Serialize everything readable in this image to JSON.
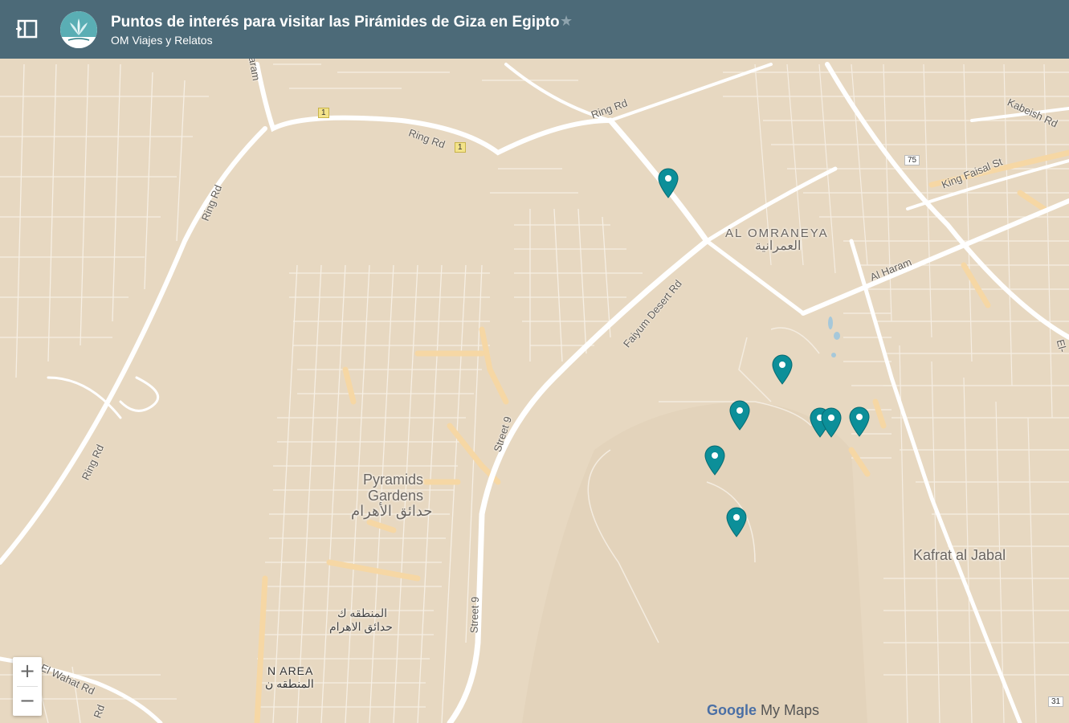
{
  "header": {
    "title": "Puntos de interés para visitar las Pirámides de Giza en Egipto",
    "author": "OM Viajes y Relatos",
    "star_icon": "star-icon",
    "toggle_icon": "sidebar-toggle-icon"
  },
  "map": {
    "roads": {
      "ring_rd_top": "Ring Rd",
      "ring_rd_mid": "Ring Rd",
      "ring_rd_left1": "Ring Rd",
      "ring_rd_left2": "Ring Rd",
      "ring_rd_right": "Ring Rd",
      "faiyum": "Faiyum Desert Rd",
      "street9_upper": "Street 9",
      "street9_lower": "Street 9",
      "al_haram": "Al Haram",
      "king_faisal": "King Faisal St",
      "kabeish": "Kabeish Rd",
      "el_wahat": "El Wahat Rd",
      "haram_top": "aram",
      "el_right": "El-",
      "rd_bottom": "Rd"
    },
    "areas": {
      "al_omraneya": "AL OMRANEYA",
      "al_omraneya_ar": "العمرانية",
      "pyramids_gardens_1": "Pyramids",
      "pyramids_gardens_2": "Gardens",
      "pyramids_gardens_ar": "حدائق الأهرام",
      "kafrat": "Kafrat al Jabal",
      "zone_ar_1": "المنطقه ك",
      "zone_ar_2": "حدائق الاهرام",
      "n_area": "N AREA",
      "n_area_ar": "المنطقه ن"
    },
    "shields": [
      "1",
      "1",
      "75",
      "31"
    ],
    "pins_count": 8,
    "pin_color": "#0c8f99"
  },
  "controls": {
    "zoom_in": "+",
    "zoom_out": "−"
  },
  "branding": {
    "google": "Google",
    "mymaps": "My Maps"
  }
}
